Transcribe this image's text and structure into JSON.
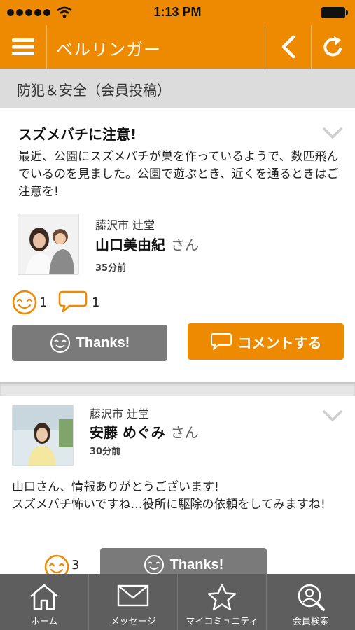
{
  "status_bar": {
    "time": "1:13 PM"
  },
  "nav": {
    "title": "ベルリンガー"
  },
  "category": {
    "label": "防犯＆安全（会員投稿）"
  },
  "post": {
    "title": "スズメバチに注意!",
    "body": "最近、公園にスズメバチが巣を作っているようで、数匹飛んでいるのを見ました。公園で遊ぶとき、近くを通るときはご注意を!",
    "author": {
      "location": "藤沢市 辻堂",
      "name": "山口美由紀",
      "honorific": "さん",
      "time_ago": "35分前"
    },
    "thanks_count": "1",
    "comment_count": "1",
    "thanks_button": "Thanks!",
    "comment_button": "コメントする"
  },
  "comment": {
    "author": {
      "location": "藤沢市 辻堂",
      "name": "安藤 めぐみ",
      "honorific": "さん",
      "time_ago": "30分前"
    },
    "body": "山口さん、情報ありがとうございます!\nスズメバチ怖いですね…役所に駆除の依頼をしてみますね!",
    "thanks_count": "3",
    "thanks_button": "Thanks!"
  },
  "tabs": [
    {
      "label": "ホーム",
      "icon": "home-icon"
    },
    {
      "label": "メッセージ",
      "icon": "mail-icon"
    },
    {
      "label": "マイコミュニティ",
      "icon": "star-icon"
    },
    {
      "label": "会員検索",
      "icon": "member-search-icon"
    }
  ],
  "colors": {
    "accent": "#ee8a00",
    "gray_button": "#7a7a7a",
    "tabbar": "#5e5e5e",
    "category_bg": "#dcdcdc"
  }
}
